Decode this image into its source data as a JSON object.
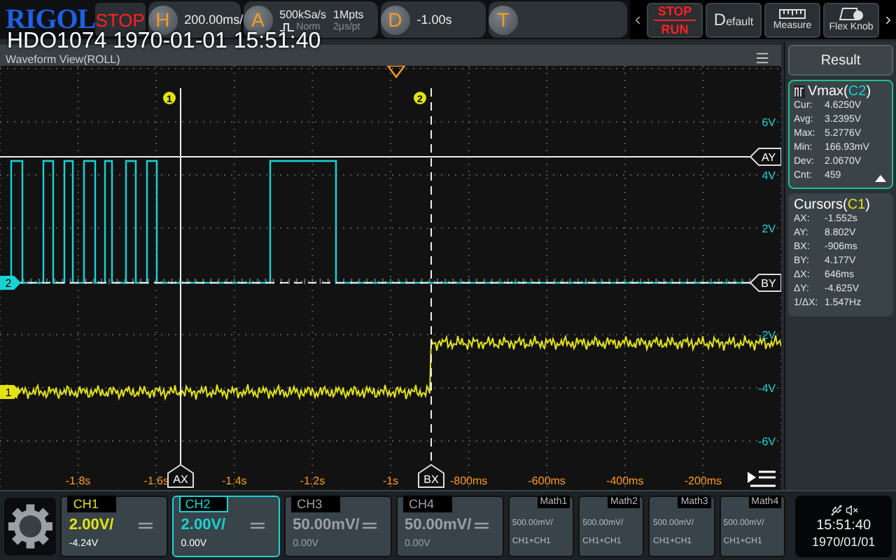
{
  "top_bar": {
    "logo": "RIGOL",
    "run_state": "STOP",
    "horizontal": {
      "key": "H",
      "value": "200.00ms/"
    },
    "acquire": {
      "key": "A",
      "sample_rate": "500kSa/s",
      "mode": "Norm",
      "depth": "1Mpts",
      "resolution": "2μs/pt"
    },
    "delay": {
      "key": "D",
      "value": "-1.00s"
    },
    "trigger": {
      "key": "T"
    }
  },
  "toolbar": [
    {
      "kind": "stoprun",
      "top": "STOP",
      "bottom": "RUN"
    },
    {
      "kind": "default",
      "label": "Default"
    },
    {
      "kind": "measure",
      "label": "Measure"
    },
    {
      "kind": "flex",
      "label": "Flex Knob"
    }
  ],
  "overlay_title": "HDO1074 1970-01-01 15:51:40",
  "waveform_view": {
    "title": "Waveform View(ROLL)",
    "y_labels": [
      "6V",
      "4V",
      "2V",
      "-2V",
      "-4V",
      "-6V"
    ],
    "x_labels": [
      "-1.8s",
      "-1.6s",
      "-1.4s",
      "-1.2s",
      "-1s",
      "-800ms",
      "-600ms",
      "-400ms",
      "-200ms"
    ],
    "cursor_markers": [
      "1",
      "2"
    ],
    "cursor_tags": {
      "ax": "AX",
      "bx": "BX",
      "ay": "AY",
      "by": "BY"
    },
    "channel_markers": [
      {
        "label": "2",
        "color": "#17d4d4"
      },
      {
        "label": "1",
        "color": "#e3e314"
      }
    ]
  },
  "result_panel": {
    "title": "Result",
    "cards": [
      {
        "kind": "measure",
        "name": "Vmax(",
        "source": "C2",
        "close": ")",
        "color": "#17d4d4",
        "rows": [
          {
            "label": "Cur:",
            "value": "4.6250V"
          },
          {
            "label": "Avg:",
            "value": "3.2395V"
          },
          {
            "label": "Max:",
            "value": "5.2776V"
          },
          {
            "label": "Min:",
            "value": "166.93mV"
          },
          {
            "label": "Dev:",
            "value": "2.0670V"
          },
          {
            "label": "Cnt:",
            "value": "459"
          }
        ]
      },
      {
        "kind": "cursors",
        "name": "Cursors(",
        "source": "C1",
        "close": ")",
        "color": "#e3e314",
        "rows": [
          {
            "label": "AX:",
            "value": "-1.552s"
          },
          {
            "label": "AY:",
            "value": "8.802V"
          },
          {
            "label": "BX:",
            "value": "-906ms"
          },
          {
            "label": "BY:",
            "value": "4.177V"
          },
          {
            "label": "ΔX:",
            "value": "646ms"
          },
          {
            "label": "ΔY:",
            "value": "-4.625V"
          },
          {
            "label": "1/ΔX:",
            "value": "1.547Hz"
          }
        ]
      }
    ]
  },
  "channels": [
    {
      "label": "CH1",
      "scale": "2.00V/",
      "offset": "-4.24V",
      "on": true,
      "selected": false,
      "color": "#e3e314"
    },
    {
      "label": "CH2",
      "scale": "2.00V/",
      "offset": "0.00V",
      "on": true,
      "selected": true,
      "color": "#17d4d4"
    },
    {
      "label": "CH3",
      "scale": "50.00mV/",
      "offset": "0.00V",
      "on": false,
      "selected": false
    },
    {
      "label": "CH4",
      "scale": "50.00mV/",
      "offset": "0.00V",
      "on": false,
      "selected": false
    }
  ],
  "math": [
    {
      "label": "Math1",
      "scale": "500.00mV/",
      "source": "CH1+CH1"
    },
    {
      "label": "Math2",
      "scale": "500.00mV/",
      "source": "CH1+CH1"
    },
    {
      "label": "Math3",
      "scale": "500.00mV/",
      "source": "CH1+CH1"
    },
    {
      "label": "Math4",
      "scale": "500.00mV/",
      "source": "CH1+CH1"
    }
  ],
  "clock": {
    "time": "15:51:40",
    "date": "1970/01/01"
  }
}
